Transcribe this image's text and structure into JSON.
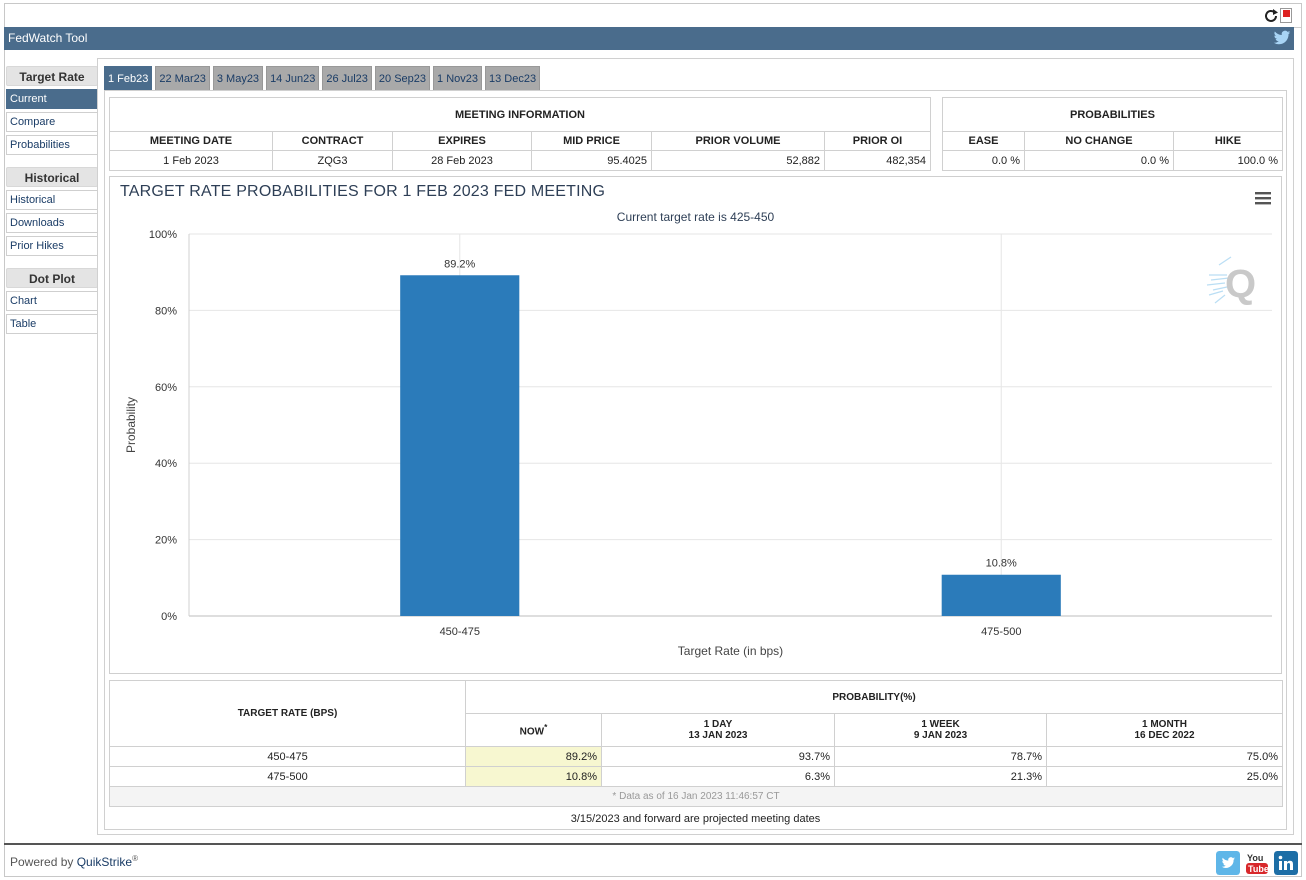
{
  "header": {
    "title": "FedWatch Tool"
  },
  "sidebar": {
    "groups": [
      {
        "title": "Target Rate",
        "items": [
          "Current",
          "Compare",
          "Probabilities"
        ]
      },
      {
        "title": "Historical",
        "items": [
          "Historical",
          "Downloads",
          "Prior Hikes"
        ]
      },
      {
        "title": "Dot Plot",
        "items": [
          "Chart",
          "Table"
        ]
      }
    ],
    "active": "Current"
  },
  "tabs": [
    "1 Feb23",
    "22 Mar23",
    "3 May23",
    "14 Jun23",
    "26 Jul23",
    "20 Sep23",
    "1 Nov23",
    "13 Dec23"
  ],
  "meeting_info": {
    "title": "MEETING INFORMATION",
    "headers": [
      "MEETING DATE",
      "CONTRACT",
      "EXPIRES",
      "MID PRICE",
      "PRIOR VOLUME",
      "PRIOR OI"
    ],
    "row": [
      "1 Feb 2023",
      "ZQG3",
      "28 Feb 2023",
      "95.4025",
      "52,882",
      "482,354"
    ]
  },
  "probabilities": {
    "title": "PROBABILITIES",
    "headers": [
      "EASE",
      "NO CHANGE",
      "HIKE"
    ],
    "row": [
      "0.0 %",
      "0.0 %",
      "100.0 %"
    ]
  },
  "chart_data": {
    "type": "bar",
    "title": "TARGET RATE PROBABILITIES FOR 1 FEB 2023 FED MEETING",
    "subtitle": "Current target rate is 425-450",
    "xlabel": "Target Rate (in bps)",
    "ylabel": "Probability",
    "categories": [
      "450-475",
      "475-500"
    ],
    "values": [
      89.2,
      10.8
    ],
    "data_labels": [
      "89.2%",
      "10.8%"
    ],
    "ylim": [
      0,
      100
    ],
    "yticks": [
      "0%",
      "20%",
      "40%",
      "60%",
      "80%",
      "100%"
    ],
    "bar_color": "#2b7bba",
    "grid": true
  },
  "prob_table": {
    "col_rate": "TARGET RATE (BPS)",
    "col_group": "PROBABILITY(%)",
    "sub_headers": [
      {
        "line1": "NOW",
        "line2": ""
      },
      {
        "line1": "1 DAY",
        "line2": "13 JAN 2023"
      },
      {
        "line1": "1 WEEK",
        "line2": "9 JAN 2023"
      },
      {
        "line1": "1 MONTH",
        "line2": "16 DEC 2022"
      }
    ],
    "rows": [
      [
        "450-475",
        "89.2%",
        "93.7%",
        "78.7%",
        "75.0%"
      ],
      [
        "475-500",
        "10.8%",
        "6.3%",
        "21.3%",
        "25.0%"
      ]
    ],
    "footnote": "* Data as of 16 Jan 2023 11:46:57 CT"
  },
  "projected_note": "3/15/2023 and forward are projected meeting dates",
  "footer": {
    "powered_by": "Powered by ",
    "brand": "QuikStrike",
    "reg": "®"
  },
  "colors": {
    "header": "#4a6c8c",
    "bar": "#2b7bba",
    "now_highlight": "#f7f7d0"
  }
}
